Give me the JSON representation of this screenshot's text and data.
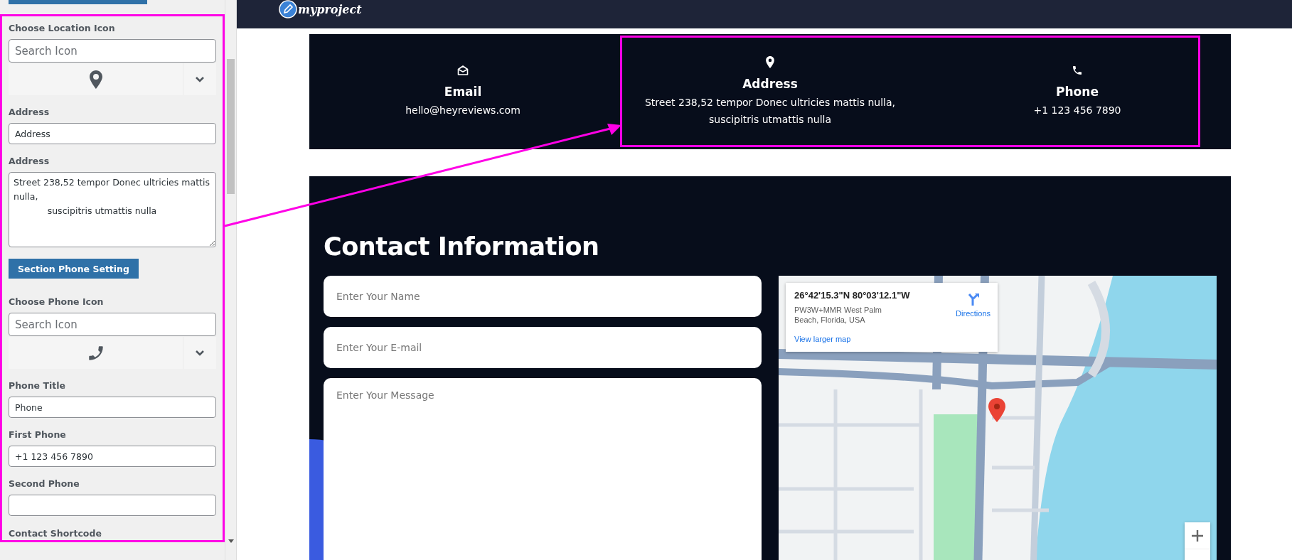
{
  "settings_panel": {
    "location_icon": {
      "label": "Choose Location Icon",
      "placeholder": "Search Icon"
    },
    "address_title": {
      "label": "Address",
      "value": "Address"
    },
    "address_text": {
      "label": "Address",
      "value": "Street 238,52 tempor Donec ultricies mattis nulla,\n            suscipitris utmattis nulla"
    },
    "phone_section_button": "Section Phone Setting",
    "phone_icon": {
      "label": "Choose Phone Icon",
      "placeholder": "Search Icon"
    },
    "phone_title": {
      "label": "Phone Title",
      "value": "Phone"
    },
    "first_phone": {
      "label": "First Phone",
      "value": "+1 123 456 7890"
    },
    "second_phone": {
      "label": "Second Phone"
    },
    "next_section_label": "Contact Shortcode"
  },
  "header": {
    "logo": "myproject"
  },
  "info_band": [
    {
      "kind": "email",
      "title": "Email",
      "lines": [
        "hello@heyreviews.com"
      ]
    },
    {
      "kind": "address",
      "title": "Address",
      "lines": [
        "Street 238,52 tempor Donec ultricies mattis nulla,",
        "suscipitris utmattis nulla"
      ]
    },
    {
      "kind": "phone",
      "title": "Phone",
      "lines": [
        "+1 123 456 7890"
      ]
    }
  ],
  "contact": {
    "title": "Contact Information",
    "fields": [
      {
        "kind": "input",
        "placeholder": "Enter Your Name"
      },
      {
        "kind": "input",
        "placeholder": "Enter Your E-mail"
      },
      {
        "kind": "textarea",
        "placeholder": "Enter Your Message"
      }
    ],
    "map": {
      "coordinates": "26°42'15.3\"N 80°03'12.1\"W",
      "address": "PW3W+MMR West Palm Beach, Florida, USA",
      "directions": "Directions",
      "larger_map_link": "View larger map"
    }
  }
}
